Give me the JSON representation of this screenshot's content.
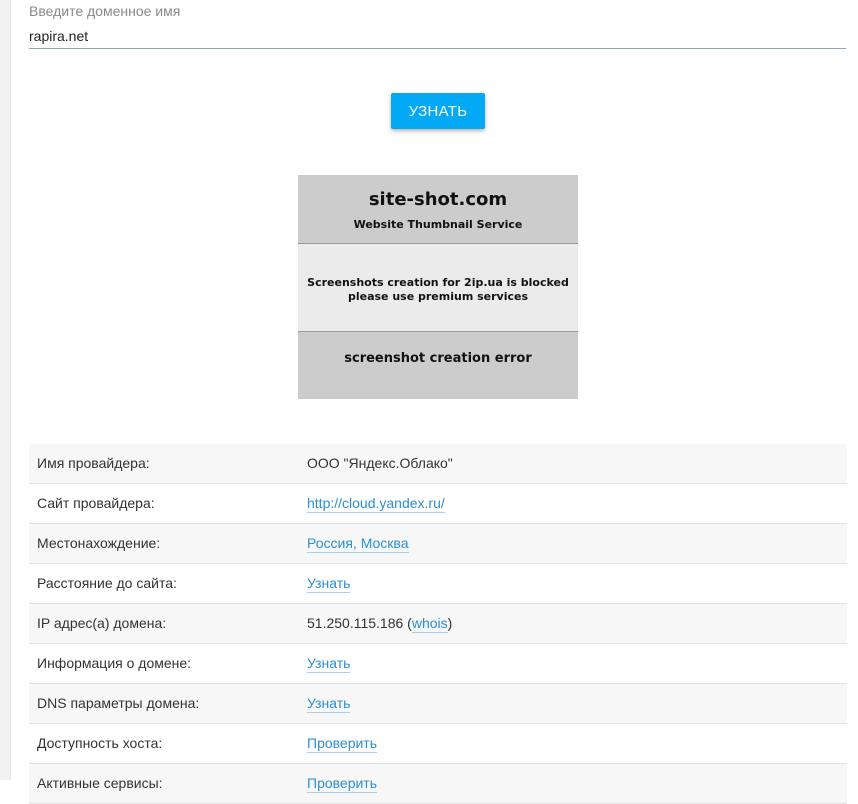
{
  "form": {
    "label": "Введите доменное имя",
    "input_value": "rapira.net",
    "button_label": "УЗНАТЬ"
  },
  "thumbnail": {
    "title": "site-shot.com",
    "subtitle": "Website Thumbnail Service",
    "message_line1": "Screenshots creation for 2ip.ua is blocked",
    "message_line2": "please use premium services",
    "error": "screenshot creation error"
  },
  "info_rows": [
    {
      "label": "Имя провайдера:",
      "value": "ООО \"Яндекс.Облако\""
    },
    {
      "label": "Сайт провайдера:",
      "link": "http://cloud.yandex.ru/"
    },
    {
      "label": "Местонахождение:",
      "link": "Россия, Москва"
    },
    {
      "label": "Расстояние до сайта:",
      "link": "Узнать"
    },
    {
      "label": "IP адрес(а) домена:",
      "ip": "51.250.115.186",
      "whois": "whois"
    },
    {
      "label": "Информация о домене:",
      "link": "Узнать"
    },
    {
      "label": "DNS параметры домена:",
      "link": "Узнать"
    },
    {
      "label": "Доступность хоста:",
      "link": "Проверить"
    },
    {
      "label": "Активные сервисы:",
      "link": "Проверить"
    }
  ],
  "colors": {
    "accent": "#03a9f4",
    "link": "#2a8fd6",
    "row_alt": "#f7f7f7"
  }
}
